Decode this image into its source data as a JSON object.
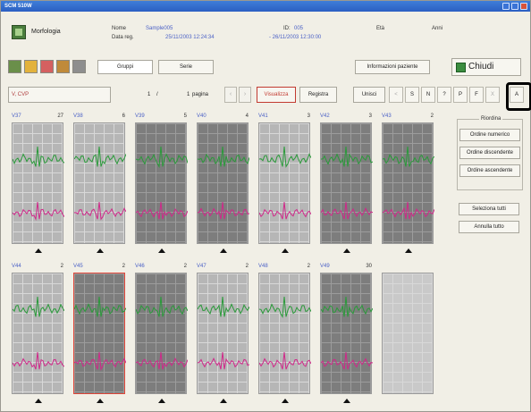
{
  "window": {
    "title": "SCM 510W"
  },
  "header": {
    "app_name": "Morfologia",
    "nome_label": "Nome",
    "nome_value": "Sample005",
    "data_label": "Data reg.",
    "data_value": "25/11/2003 12:24:34",
    "id_label": "ID:",
    "id_value": "005",
    "data_end": "- 26/11/2003 12:30:00",
    "eta_label": "Età",
    "anni_label": "Anni"
  },
  "toolbar": {
    "tab_gruppi": "Gruppi",
    "tab_serie": "Serie",
    "info_button": "Informazioni paziente",
    "close_button": "Chiudi"
  },
  "nav": {
    "filter_value": "V, CVP",
    "page_current": "1",
    "page_sep": "/",
    "page_total": "1",
    "page_word": "pagina",
    "visualizza": "Visualizza",
    "registra": "Registra",
    "unisci": "Unisci",
    "letters": [
      "<",
      "S",
      "N",
      "?",
      "P",
      "F",
      "X",
      "A"
    ]
  },
  "strips": [
    {
      "name": "V37",
      "count": "27",
      "dark": false,
      "selected": false
    },
    {
      "name": "V38",
      "count": "6",
      "dark": false,
      "selected": false
    },
    {
      "name": "V39",
      "count": "5",
      "dark": true,
      "selected": false
    },
    {
      "name": "V40",
      "count": "4",
      "dark": true,
      "selected": false
    },
    {
      "name": "V41",
      "count": "3",
      "dark": false,
      "selected": false
    },
    {
      "name": "V42",
      "count": "3",
      "dark": true,
      "selected": false
    },
    {
      "name": "V43",
      "count": "2",
      "dark": true,
      "selected": false
    },
    {
      "name": "V44",
      "count": "2",
      "dark": false,
      "selected": false
    },
    {
      "name": "V45",
      "count": "2",
      "dark": true,
      "selected": true
    },
    {
      "name": "V46",
      "count": "2",
      "dark": true,
      "selected": false
    },
    {
      "name": "V47",
      "count": "2",
      "dark": false,
      "selected": false
    },
    {
      "name": "V48",
      "count": "2",
      "dark": false,
      "selected": false
    },
    {
      "name": "V49",
      "count": "30",
      "dark": true,
      "selected": false
    },
    {
      "name": "",
      "count": "",
      "dark": false,
      "selected": false,
      "empty": true
    }
  ],
  "sidebar": {
    "group_title": "Riordina",
    "ordine_numerico": "Ordine numerico",
    "ordine_discendente": "Ordine discendente",
    "ordine_ascendente": "Ordine ascendente",
    "seleziona_tutti": "Seleziona tutti",
    "annulla_tutto": "Annulla tutto"
  },
  "colors": {
    "green_trace": "#2a9a3a",
    "pink_trace": "#d0288a",
    "accent_red": "#e0463a"
  }
}
